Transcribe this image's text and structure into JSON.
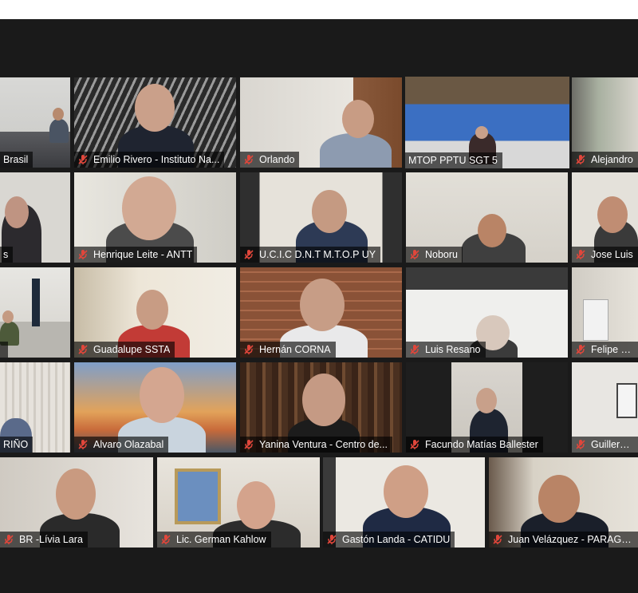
{
  "meeting": {
    "active_speaker": "MTOP PPTU SGT 5",
    "mute_icon": "mic-muted-icon",
    "muted_color": "#e0463b",
    "active_border_color": "#c3e84a",
    "participants": [
      {
        "name": "Brasil",
        "muted": false
      },
      {
        "name": "Emilio Rivero - Instituto Na...",
        "muted": true
      },
      {
        "name": "Orlando",
        "muted": true
      },
      {
        "name": "MTOP PPTU SGT 5",
        "muted": false
      },
      {
        "name": "Alejandro",
        "muted": true
      },
      {
        "name": "s",
        "muted": false
      },
      {
        "name": "Henrique Leite - ANTT",
        "muted": true
      },
      {
        "name": "U.C.I.C D.N.T M.T.O.P UY",
        "muted": true
      },
      {
        "name": "Noboru",
        "muted": true
      },
      {
        "name": "Jose Luis",
        "muted": true
      },
      {
        "name": "",
        "muted": false
      },
      {
        "name": "Guadalupe SSTA",
        "muted": true
      },
      {
        "name": "Hernán CORNA",
        "muted": true
      },
      {
        "name": "Luis Resano",
        "muted": true
      },
      {
        "name": "Felipe Fre",
        "muted": true
      },
      {
        "name": "RIÑO",
        "muted": false
      },
      {
        "name": "Alvaro Olazabal",
        "muted": true
      },
      {
        "name": "Yanina Ventura - Centro de...",
        "muted": true
      },
      {
        "name": "Facundo Matías Ballester",
        "muted": true
      },
      {
        "name": "Guillermo",
        "muted": true
      },
      {
        "name": "BR -Lívia Lara",
        "muted": true
      },
      {
        "name": "Lic. German Kahlow",
        "muted": true
      },
      {
        "name": "Gastón Landa - CATIDU",
        "muted": true
      },
      {
        "name": "Juan Velázquez - PARAGUA",
        "muted": true
      }
    ]
  }
}
